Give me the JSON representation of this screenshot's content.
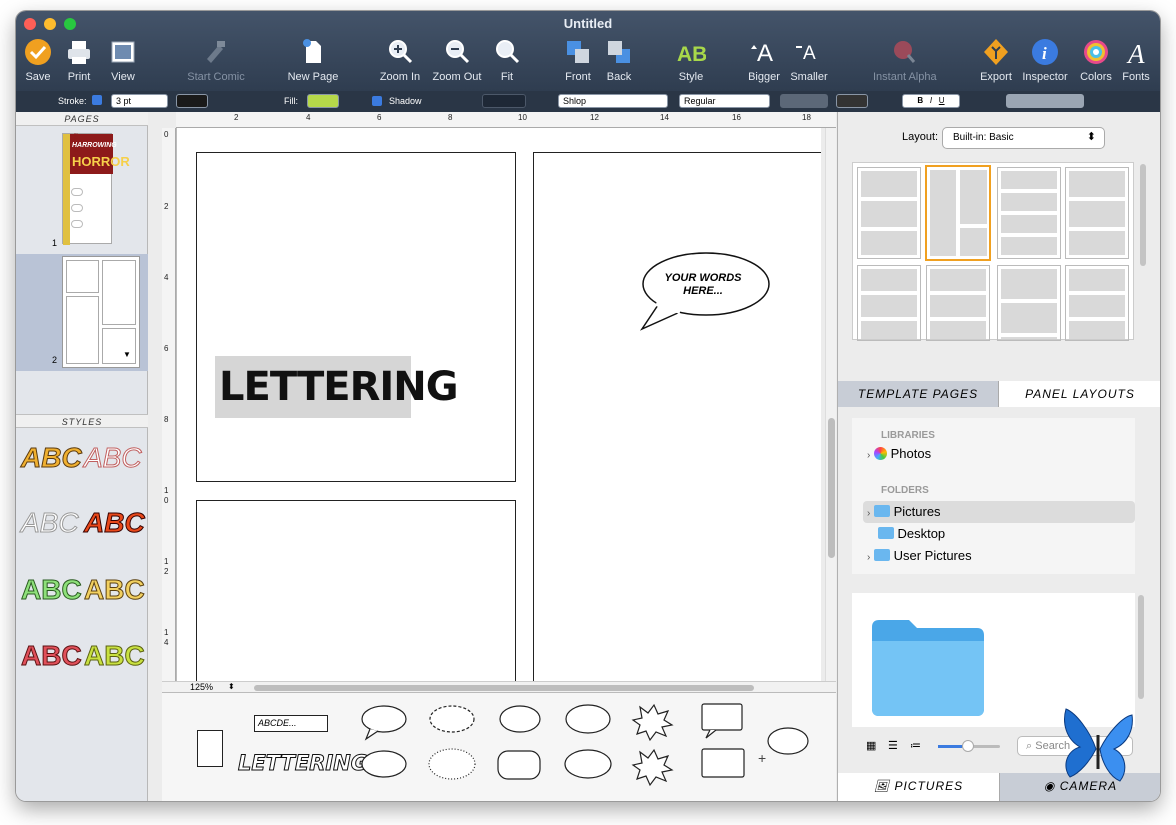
{
  "window": {
    "title": "Untitled"
  },
  "toolbar": {
    "items": [
      {
        "label": "Save",
        "icon": "save-icon"
      },
      {
        "label": "Print",
        "icon": "print-icon"
      },
      {
        "label": "View",
        "icon": "view-icon"
      },
      {
        "label": "Start Comic",
        "icon": "start-comic-icon",
        "disabled": true
      },
      {
        "label": "New Page",
        "icon": "new-page-icon"
      },
      {
        "label": "Zoom In",
        "icon": "zoom-in-icon"
      },
      {
        "label": "Zoom Out",
        "icon": "zoom-out-icon"
      },
      {
        "label": "Fit",
        "icon": "fit-icon"
      },
      {
        "label": "Front",
        "icon": "front-icon"
      },
      {
        "label": "Back",
        "icon": "back-icon"
      },
      {
        "label": "Style",
        "icon": "style-icon"
      },
      {
        "label": "Bigger",
        "icon": "bigger-icon"
      },
      {
        "label": "Smaller",
        "icon": "smaller-icon"
      },
      {
        "label": "Instant Alpha",
        "icon": "instant-alpha-icon",
        "disabled": true
      },
      {
        "label": "Export",
        "icon": "export-icon"
      },
      {
        "label": "Inspector",
        "icon": "inspector-icon"
      },
      {
        "label": "Colors",
        "icon": "colors-icon"
      },
      {
        "label": "Fonts",
        "icon": "fonts-icon"
      }
    ]
  },
  "format": {
    "stroke_label": "Stroke:",
    "stroke_size": "3 pt",
    "fill_label": "Fill:",
    "shadow_label": "Shadow",
    "font": "Shlop",
    "weight": "Regular",
    "bold": "B",
    "italic": "I",
    "underline": "U",
    "fill_color": "#b6d84a",
    "stroke_color": "#1a1a1a"
  },
  "sidebar": {
    "pages_header": "PAGES",
    "page_numbers": [
      "1",
      "2"
    ],
    "styles_header": "STYLES",
    "cover": {
      "tag": "REALLY SCARY!",
      "title1": "HARROWING",
      "title2": "HORROR"
    },
    "style_samples": [
      "ABC",
      "ABC",
      "ABC",
      "ABC",
      "ABC",
      "ABC",
      "ABC",
      "ABC"
    ]
  },
  "ruler": {
    "h": [
      "2",
      "4",
      "6",
      "8",
      "10",
      "12",
      "14",
      "16",
      "18"
    ],
    "v": [
      "0",
      "2",
      "4",
      "6",
      "8",
      "1",
      "0",
      "1",
      "2",
      "1",
      "4"
    ]
  },
  "canvas": {
    "lettering": "LETTERING",
    "bubble_text": "YOUR WORDS HERE...",
    "zoom": "125%"
  },
  "right": {
    "layout_label": "Layout:",
    "layout_value": "Built-in: Basic",
    "tabs": [
      "TEMPLATE PAGES",
      "PANEL LAYOUTS"
    ],
    "libraries_header": "LIBRARIES",
    "libraries": [
      "Photos"
    ],
    "folders_header": "FOLDERS",
    "folders": [
      "Pictures",
      "Desktop",
      "User Pictures"
    ],
    "search_placeholder": "Search",
    "bottom_tabs": [
      "PICTURES",
      "CAMERA"
    ]
  },
  "palette": {
    "caption_sample": "ABCDE...",
    "lettering_sample": "LETTERING"
  },
  "colors": {
    "accent": "#f0a020",
    "selection": "#b9c3d6"
  }
}
